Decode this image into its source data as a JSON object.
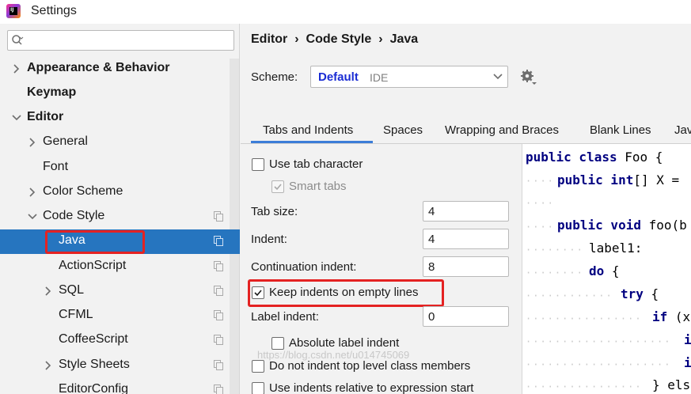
{
  "window": {
    "title": "Settings",
    "icon": "intellij-idea-icon"
  },
  "sidebar": {
    "search": {
      "placeholder": "",
      "value": ""
    },
    "items": [
      {
        "label": "Appearance & Behavior",
        "bold": true,
        "arrow": "right",
        "copy": false
      },
      {
        "label": "Keymap",
        "bold": true,
        "arrow": "none",
        "copy": false
      },
      {
        "label": "Editor",
        "bold": true,
        "arrow": "down",
        "copy": false
      },
      {
        "label": "General",
        "bold": false,
        "arrow": "right",
        "copy": false
      },
      {
        "label": "Font",
        "bold": false,
        "arrow": "none",
        "copy": false
      },
      {
        "label": "Color Scheme",
        "bold": false,
        "arrow": "right",
        "copy": false
      },
      {
        "label": "Code Style",
        "bold": false,
        "arrow": "down",
        "copy": true
      },
      {
        "label": "Java",
        "bold": false,
        "arrow": "none",
        "copy": true,
        "selected": true
      },
      {
        "label": "ActionScript",
        "bold": false,
        "arrow": "none",
        "copy": true
      },
      {
        "label": "SQL",
        "bold": false,
        "arrow": "right",
        "copy": true
      },
      {
        "label": "CFML",
        "bold": false,
        "arrow": "none",
        "copy": true
      },
      {
        "label": "CoffeeScript",
        "bold": false,
        "arrow": "none",
        "copy": true
      },
      {
        "label": "Style Sheets",
        "bold": false,
        "arrow": "right",
        "copy": true
      },
      {
        "label": "EditorConfig",
        "bold": false,
        "arrow": "none",
        "copy": true
      }
    ]
  },
  "breadcrumb": {
    "part1": "Editor",
    "part2": "Code Style",
    "part3": "Java",
    "separator": "›"
  },
  "scheme": {
    "label": "Scheme:",
    "name": "Default",
    "kind": "IDE"
  },
  "tabs": [
    {
      "label": "Tabs and Indents",
      "active": true
    },
    {
      "label": "Spaces"
    },
    {
      "label": "Wrapping and Braces"
    },
    {
      "label": "Blank Lines"
    },
    {
      "label": "Jav"
    }
  ],
  "options": {
    "use_tab_character": {
      "label": "Use tab character",
      "checked": false
    },
    "smart_tabs": {
      "label": "Smart tabs",
      "checked": true,
      "disabled": true
    },
    "tab_size": {
      "label": "Tab size:",
      "value": "4"
    },
    "indent": {
      "label": "Indent:",
      "value": "4"
    },
    "continuation_indent": {
      "label": "Continuation indent:",
      "value": "8"
    },
    "keep_indents_empty": {
      "label": "Keep indents on empty lines",
      "checked": true
    },
    "label_indent": {
      "label": "Label indent:",
      "value": "0"
    },
    "absolute_label_indent": {
      "label": "Absolute label indent",
      "checked": false
    },
    "no_indent_top_level": {
      "label": "Do not indent top level class members",
      "checked": false
    },
    "indents_relative": {
      "label": "Use indents relative to expression start",
      "checked": false
    }
  },
  "preview": {
    "lines": [
      {
        "kw": "public class",
        "rest": " Foo {"
      },
      {
        "kw": "public int",
        "rest": "[] X ="
      },
      {
        "kw": "",
        "rest": ""
      },
      {
        "kw": "public void",
        "rest": " foo(b"
      },
      {
        "kw": "",
        "rest": "label1:"
      },
      {
        "kw": "do",
        "rest": " {"
      },
      {
        "kw": "try",
        "rest": " {"
      },
      {
        "kw": "if",
        "rest": " (x"
      },
      {
        "kw": "i",
        "rest": ""
      },
      {
        "kw": "i",
        "rest": ""
      },
      {
        "kw": "",
        "rest": "} els"
      }
    ]
  },
  "watermark": "https://blog.csdn.net/u014745069",
  "colors": {
    "selection": "#2675bf",
    "highlight_box": "#e42222",
    "scheme_name": "#1a2cd4",
    "tab_underline": "#3b7dd8",
    "keyword": "#000080"
  }
}
